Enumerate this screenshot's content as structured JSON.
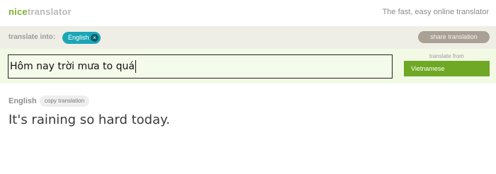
{
  "header": {
    "logo_part1": "nice",
    "logo_part2": "translator",
    "tagline": "The fast, easy online translator"
  },
  "target_bar": {
    "label": "translate into:",
    "selected_language": "English",
    "chip_close_glyph": "×",
    "share_label": "share translation"
  },
  "source": {
    "text": "Hôm nay trời mưa to quá",
    "from_label": "translate from",
    "from_language": "Vietnamese"
  },
  "result": {
    "language": "English",
    "copy_label": "copy translation",
    "text": "It's raining so hard today."
  },
  "colors": {
    "brand_green": "#7fae2f",
    "chip_teal": "#1aa6b7",
    "from_green": "#6ea824",
    "share_gray": "#a9a096"
  },
  "icons": {
    "chip_close": "close-icon"
  }
}
